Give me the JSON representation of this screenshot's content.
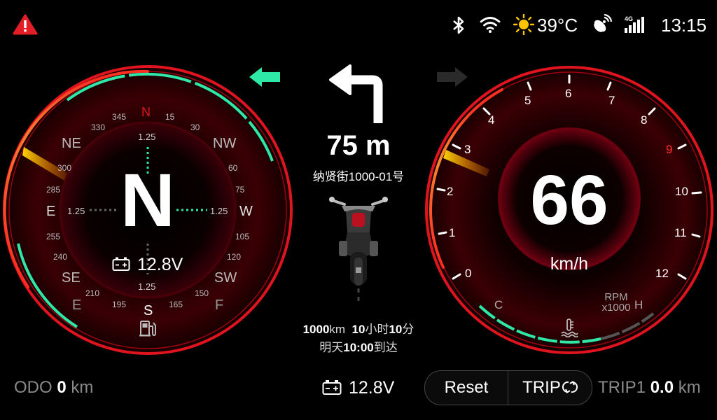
{
  "status": {
    "temperature": "39°C",
    "time": "13:15",
    "signal_gen": "4G",
    "icons": [
      "warning-icon",
      "bluetooth-icon",
      "wifi-icon",
      "sun-icon",
      "satellite-icon",
      "cellular-signal-icon"
    ]
  },
  "compass": {
    "heading_letter": "N",
    "labels": {
      "n": "N",
      "s": "S",
      "e": "E",
      "w": "W",
      "ne": "NE",
      "nw": "NW",
      "se": "SE",
      "sw": "SW",
      "e2": "E",
      "f": "F"
    },
    "degree_ticks": [
      "345",
      "15",
      "330",
      "30",
      "300",
      "60",
      "285",
      "75",
      "255",
      "105",
      "240",
      "120",
      "210",
      "150",
      "195",
      "165"
    ],
    "offsets": {
      "top": "1.25",
      "bottom": "1.25",
      "left": "1.25",
      "right": "1.25"
    },
    "voltage": "12.8V"
  },
  "navigation": {
    "distance": "75 m",
    "street": "纳贤街1000-01号",
    "remaining_distance": "1000",
    "remaining_distance_unit": "km",
    "remaining_hours": "10",
    "hours_unit": "小时",
    "remaining_minutes": "10",
    "minutes_unit": "分",
    "arrival_prefix": "明天",
    "arrival_time": "10:00",
    "arrival_suffix": "到达"
  },
  "speedometer": {
    "speed": "66",
    "unit": "km/h",
    "rpm_scale": [
      "0",
      "1",
      "2",
      "3",
      "4",
      "5",
      "6",
      "7",
      "8",
      "9",
      "10",
      "11",
      "12"
    ],
    "rpm_label_line1": "RPM",
    "rpm_label_line2": "x1000",
    "temp_cold": "C",
    "temp_hot": "H"
  },
  "bottom": {
    "odo_label": "ODO",
    "odo_value": "0",
    "odo_unit": "km",
    "voltage": "12.8V",
    "reset_label": "Reset",
    "trip_label": "TRIP",
    "trip1_label": "TRIP1",
    "trip1_value": "0.0",
    "trip1_unit": "km"
  },
  "colors": {
    "accent_green": "#2ee8a8",
    "red": "#e0141e",
    "warning_red": "#e41e26",
    "yellow": "#ffc400",
    "redline": "#ff3030"
  }
}
